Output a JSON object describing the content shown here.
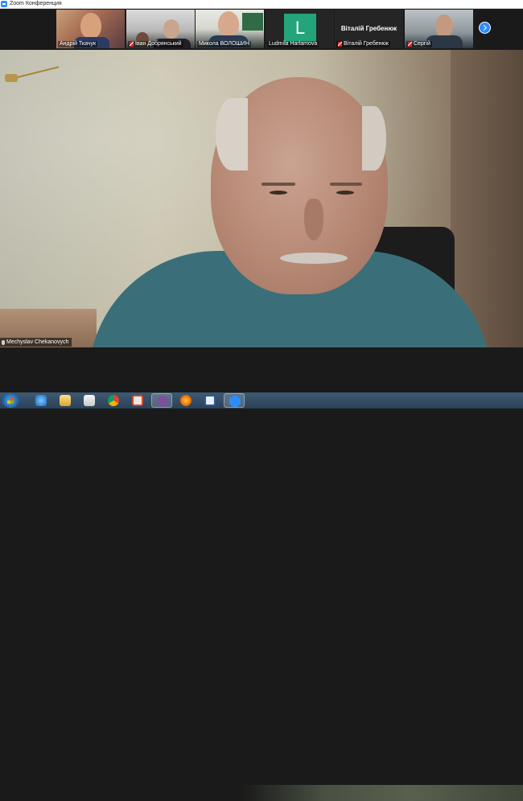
{
  "window": {
    "title": "Zoom Конференция"
  },
  "thumbnails": [
    {
      "name": "Андрій Ткачук",
      "muted": false
    },
    {
      "name": "Іван Добрянський",
      "muted": true
    },
    {
      "name": "Микола ВОЛОШИН",
      "muted": false
    },
    {
      "name": "Ludmila Harlamova",
      "muted": false,
      "avatar_letter": "L",
      "avatar_color": "#23a47a"
    },
    {
      "name": "Віталій Гребенюк",
      "muted": true,
      "display_name": "Віталій Гребенюк"
    },
    {
      "name": "Сергій",
      "muted": true
    }
  ],
  "speaker": {
    "name": "Mechyslav Chekanovych"
  },
  "icons": {
    "next": "chevron-right-icon",
    "taskbar": [
      "start-icon",
      "ie-icon",
      "explorer-icon",
      "media-player-icon",
      "chrome-icon",
      "slides-icon",
      "viber-icon",
      "firefox-icon",
      "word-icon",
      "zoom-icon"
    ]
  },
  "colors": {
    "zoom_blue": "#2d8cff",
    "mute_red": "#e02828",
    "taskbar": "#2a4258"
  }
}
